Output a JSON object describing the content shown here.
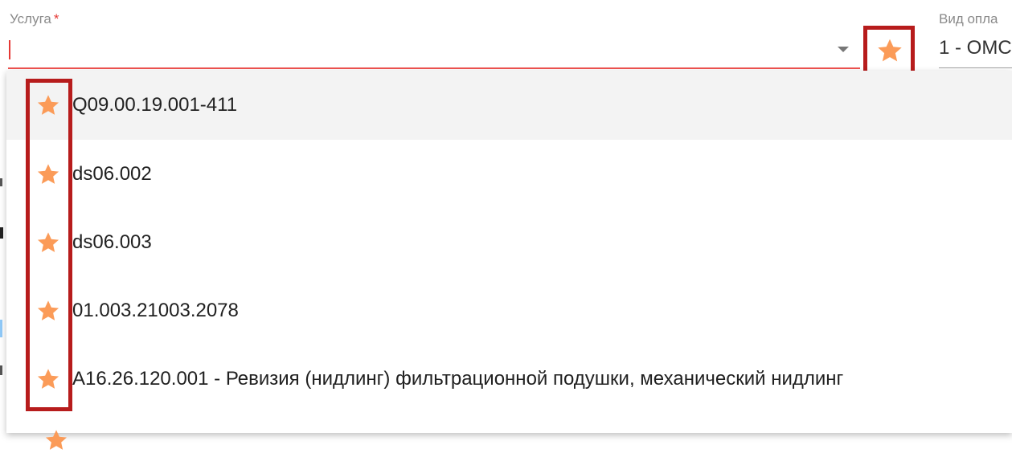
{
  "service_field": {
    "label": "Услуга",
    "required_mark": "*",
    "value": "",
    "placeholder": ""
  },
  "payment_field": {
    "label": "Вид опла",
    "value": "1 - ОМС"
  },
  "favorite_icon_color": "#fb9b58",
  "highlight_color": "#b71c1c",
  "dropdown": {
    "options": [
      {
        "label": "Q09.00.19.001-411",
        "favorite": true
      },
      {
        "label": "ds06.002",
        "favorite": true
      },
      {
        "label": "ds06.003",
        "favorite": true
      },
      {
        "label": "01.003.21003.2078",
        "favorite": true
      },
      {
        "label": "A16.26.120.001 - Ревизия (нидлинг) фильтрационной подушки, механический нидлинг",
        "favorite": true
      }
    ]
  }
}
